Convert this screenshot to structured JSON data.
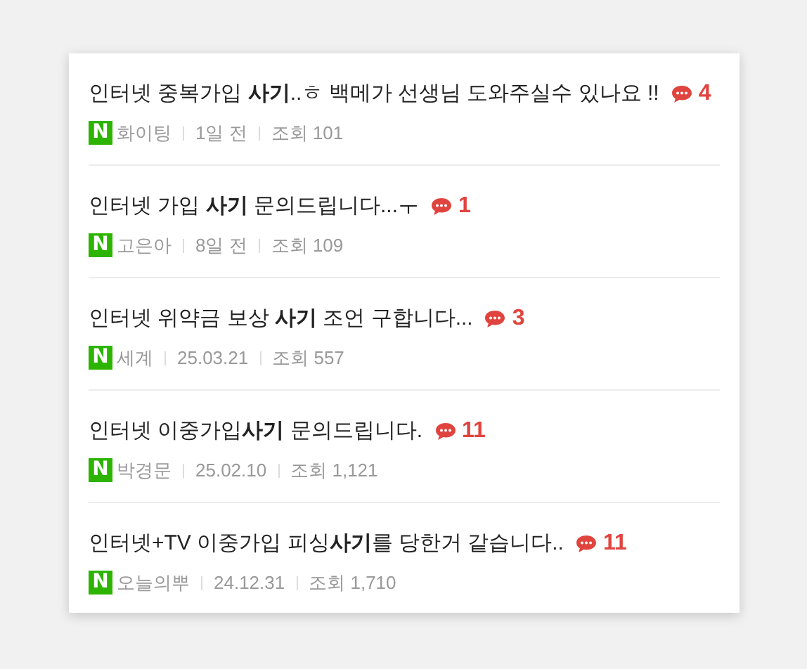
{
  "posts": [
    {
      "title": "인터넷 중복가입 **사기**..ㅎ 백메가 선생님 도와주실수 있나요 !!",
      "comments": "4",
      "badge": "N",
      "author": "화이팅",
      "date": "1일 전",
      "views": "조회 101"
    },
    {
      "title": "인터넷 가입 **사기** 문의드립니다...ㅜ",
      "comments": "1",
      "badge": "N",
      "author": "고은아",
      "date": "8일 전",
      "views": "조회 109"
    },
    {
      "title": "인터넷 위약금 보상 **사기** 조언 구합니다...",
      "comments": "3",
      "badge": "N",
      "author": "세계",
      "date": "25.03.21",
      "views": "조회 557"
    },
    {
      "title": "인터넷 이중가입**사기** 문의드립니다.",
      "comments": "11",
      "badge": "N",
      "author": "박경문",
      "date": "25.02.10",
      "views": "조회 1,121"
    },
    {
      "title": "인터넷+TV 이중가입 피싱**사기**를 당한거 같습니다..",
      "comments": "11",
      "badge": "N",
      "author": "오늘의뿌",
      "date": "24.12.31",
      "views": "조회 1,710"
    }
  ]
}
